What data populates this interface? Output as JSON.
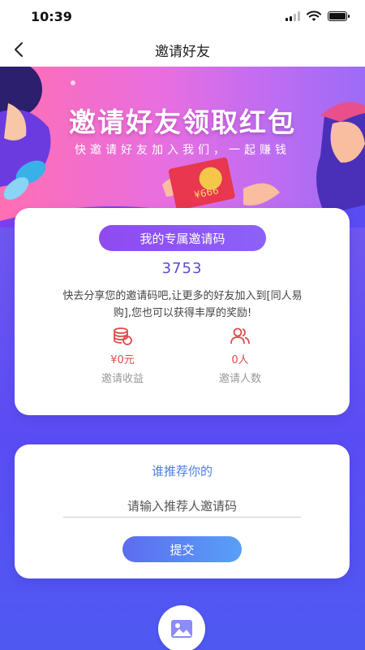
{
  "status_bar": {
    "time": "10:39"
  },
  "nav": {
    "title": "邀请好友"
  },
  "banner": {
    "title": "邀请好友领取红包",
    "subtitle": "快邀请好友加入我们，一起赚钱",
    "envelope_text": "¥666"
  },
  "invite_card": {
    "pill_label": "我的专属邀请码",
    "code": "3753",
    "description": "快去分享您的邀请码吧,让更多的好友加入到[同人易购],您也可以获得丰厚的奖励!",
    "stats": [
      {
        "icon": "coins-icon",
        "value": "¥0元",
        "label": "邀请收益"
      },
      {
        "icon": "users-icon",
        "value": "0人",
        "label": "邀请人数"
      }
    ]
  },
  "referrer_card": {
    "title": "谁推荐你的",
    "input_value": "",
    "input_placeholder": "请输入推荐人邀请码",
    "submit_label": "提交"
  },
  "colors": {
    "accent_purple": "#8c62f8",
    "code_blue": "#5b4ad6",
    "stat_red": "#e04a4a",
    "link_blue": "#4b7ee0"
  }
}
